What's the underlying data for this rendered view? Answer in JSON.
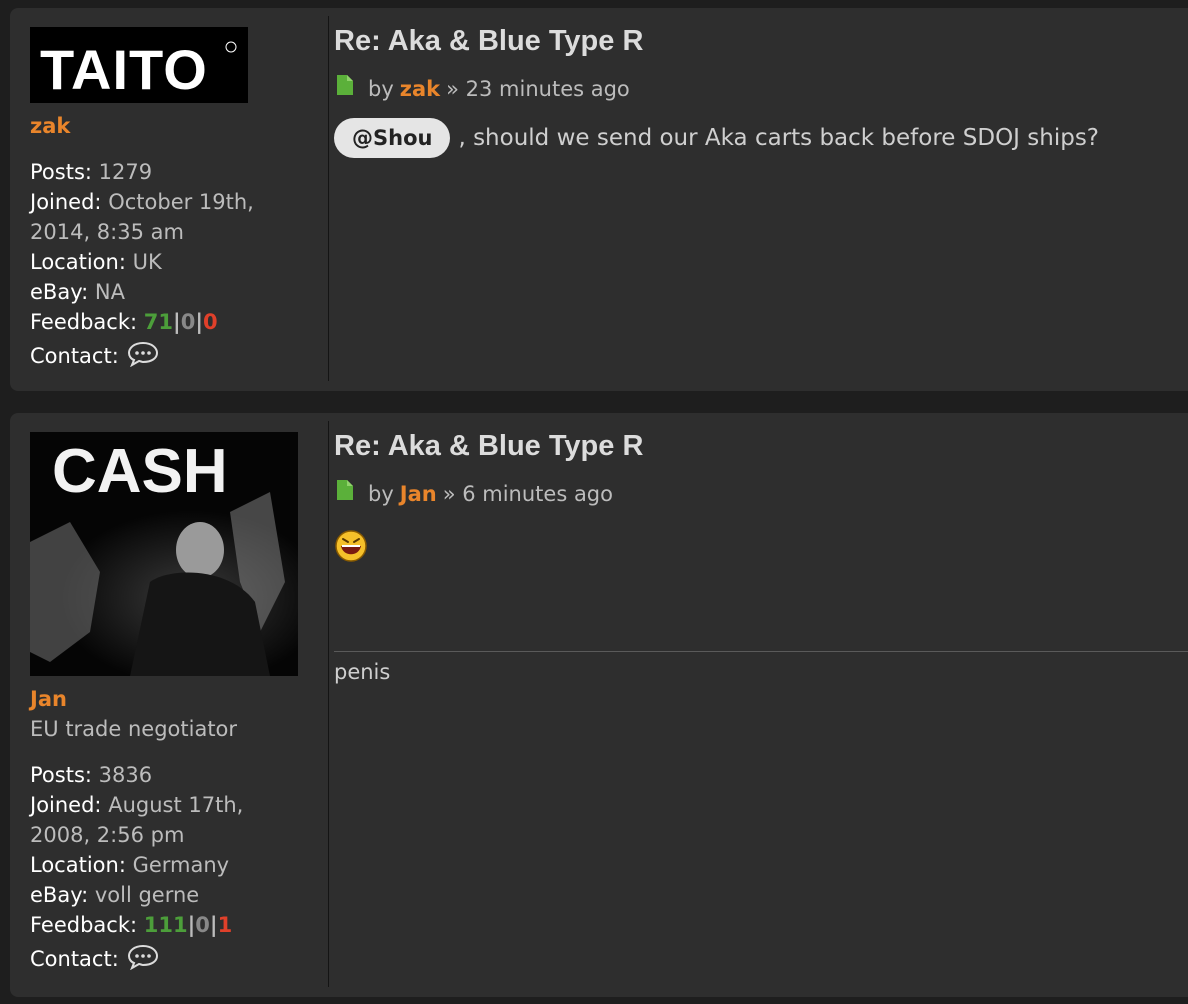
{
  "posts": [
    {
      "avatar": {
        "text": "TAITO"
      },
      "username": "zak",
      "rank": "",
      "stats": {
        "posts_label": "Posts:",
        "posts": "1279",
        "joined_label": "Joined:",
        "joined_1": "October 19th,",
        "joined_2": "2014, 8:35 am",
        "location_label": "Location:",
        "location": "UK",
        "ebay_label": "eBay:",
        "ebay": "NA",
        "feedback_label": "Feedback:",
        "fb_pos": "71",
        "fb_neu": "0",
        "fb_neg": "0",
        "contact_label": "Contact:"
      },
      "title": "Re: Aka & Blue Type R",
      "by": "by",
      "author": "zak",
      "time": "» 23 minutes ago",
      "mention": "@Shou",
      "content": ", should we send our Aka carts back before SDOJ ships?"
    },
    {
      "avatar": {
        "text": "CASH"
      },
      "username": "Jan",
      "rank": "EU trade negotiator",
      "stats": {
        "posts_label": "Posts:",
        "posts": "3836",
        "joined_label": "Joined:",
        "joined_1": "August 17th,",
        "joined_2": "2008, 2:56 pm",
        "location_label": "Location:",
        "location": "Germany",
        "ebay_label": "eBay:",
        "ebay": "voll gerne",
        "feedback_label": "Feedback:",
        "fb_pos": "111",
        "fb_neu": "0",
        "fb_neg": "1",
        "contact_label": "Contact:"
      },
      "title": "Re: Aka & Blue Type R",
      "by": "by",
      "author": "Jan",
      "time": "» 6 minutes ago",
      "content_icon": "laughing-smiley-icon",
      "signature": "penis"
    }
  ],
  "colors": {
    "accent": "#e9852b",
    "positive": "#4c9e3a",
    "negative": "#e0402a",
    "panel": "#2e2e2e"
  }
}
